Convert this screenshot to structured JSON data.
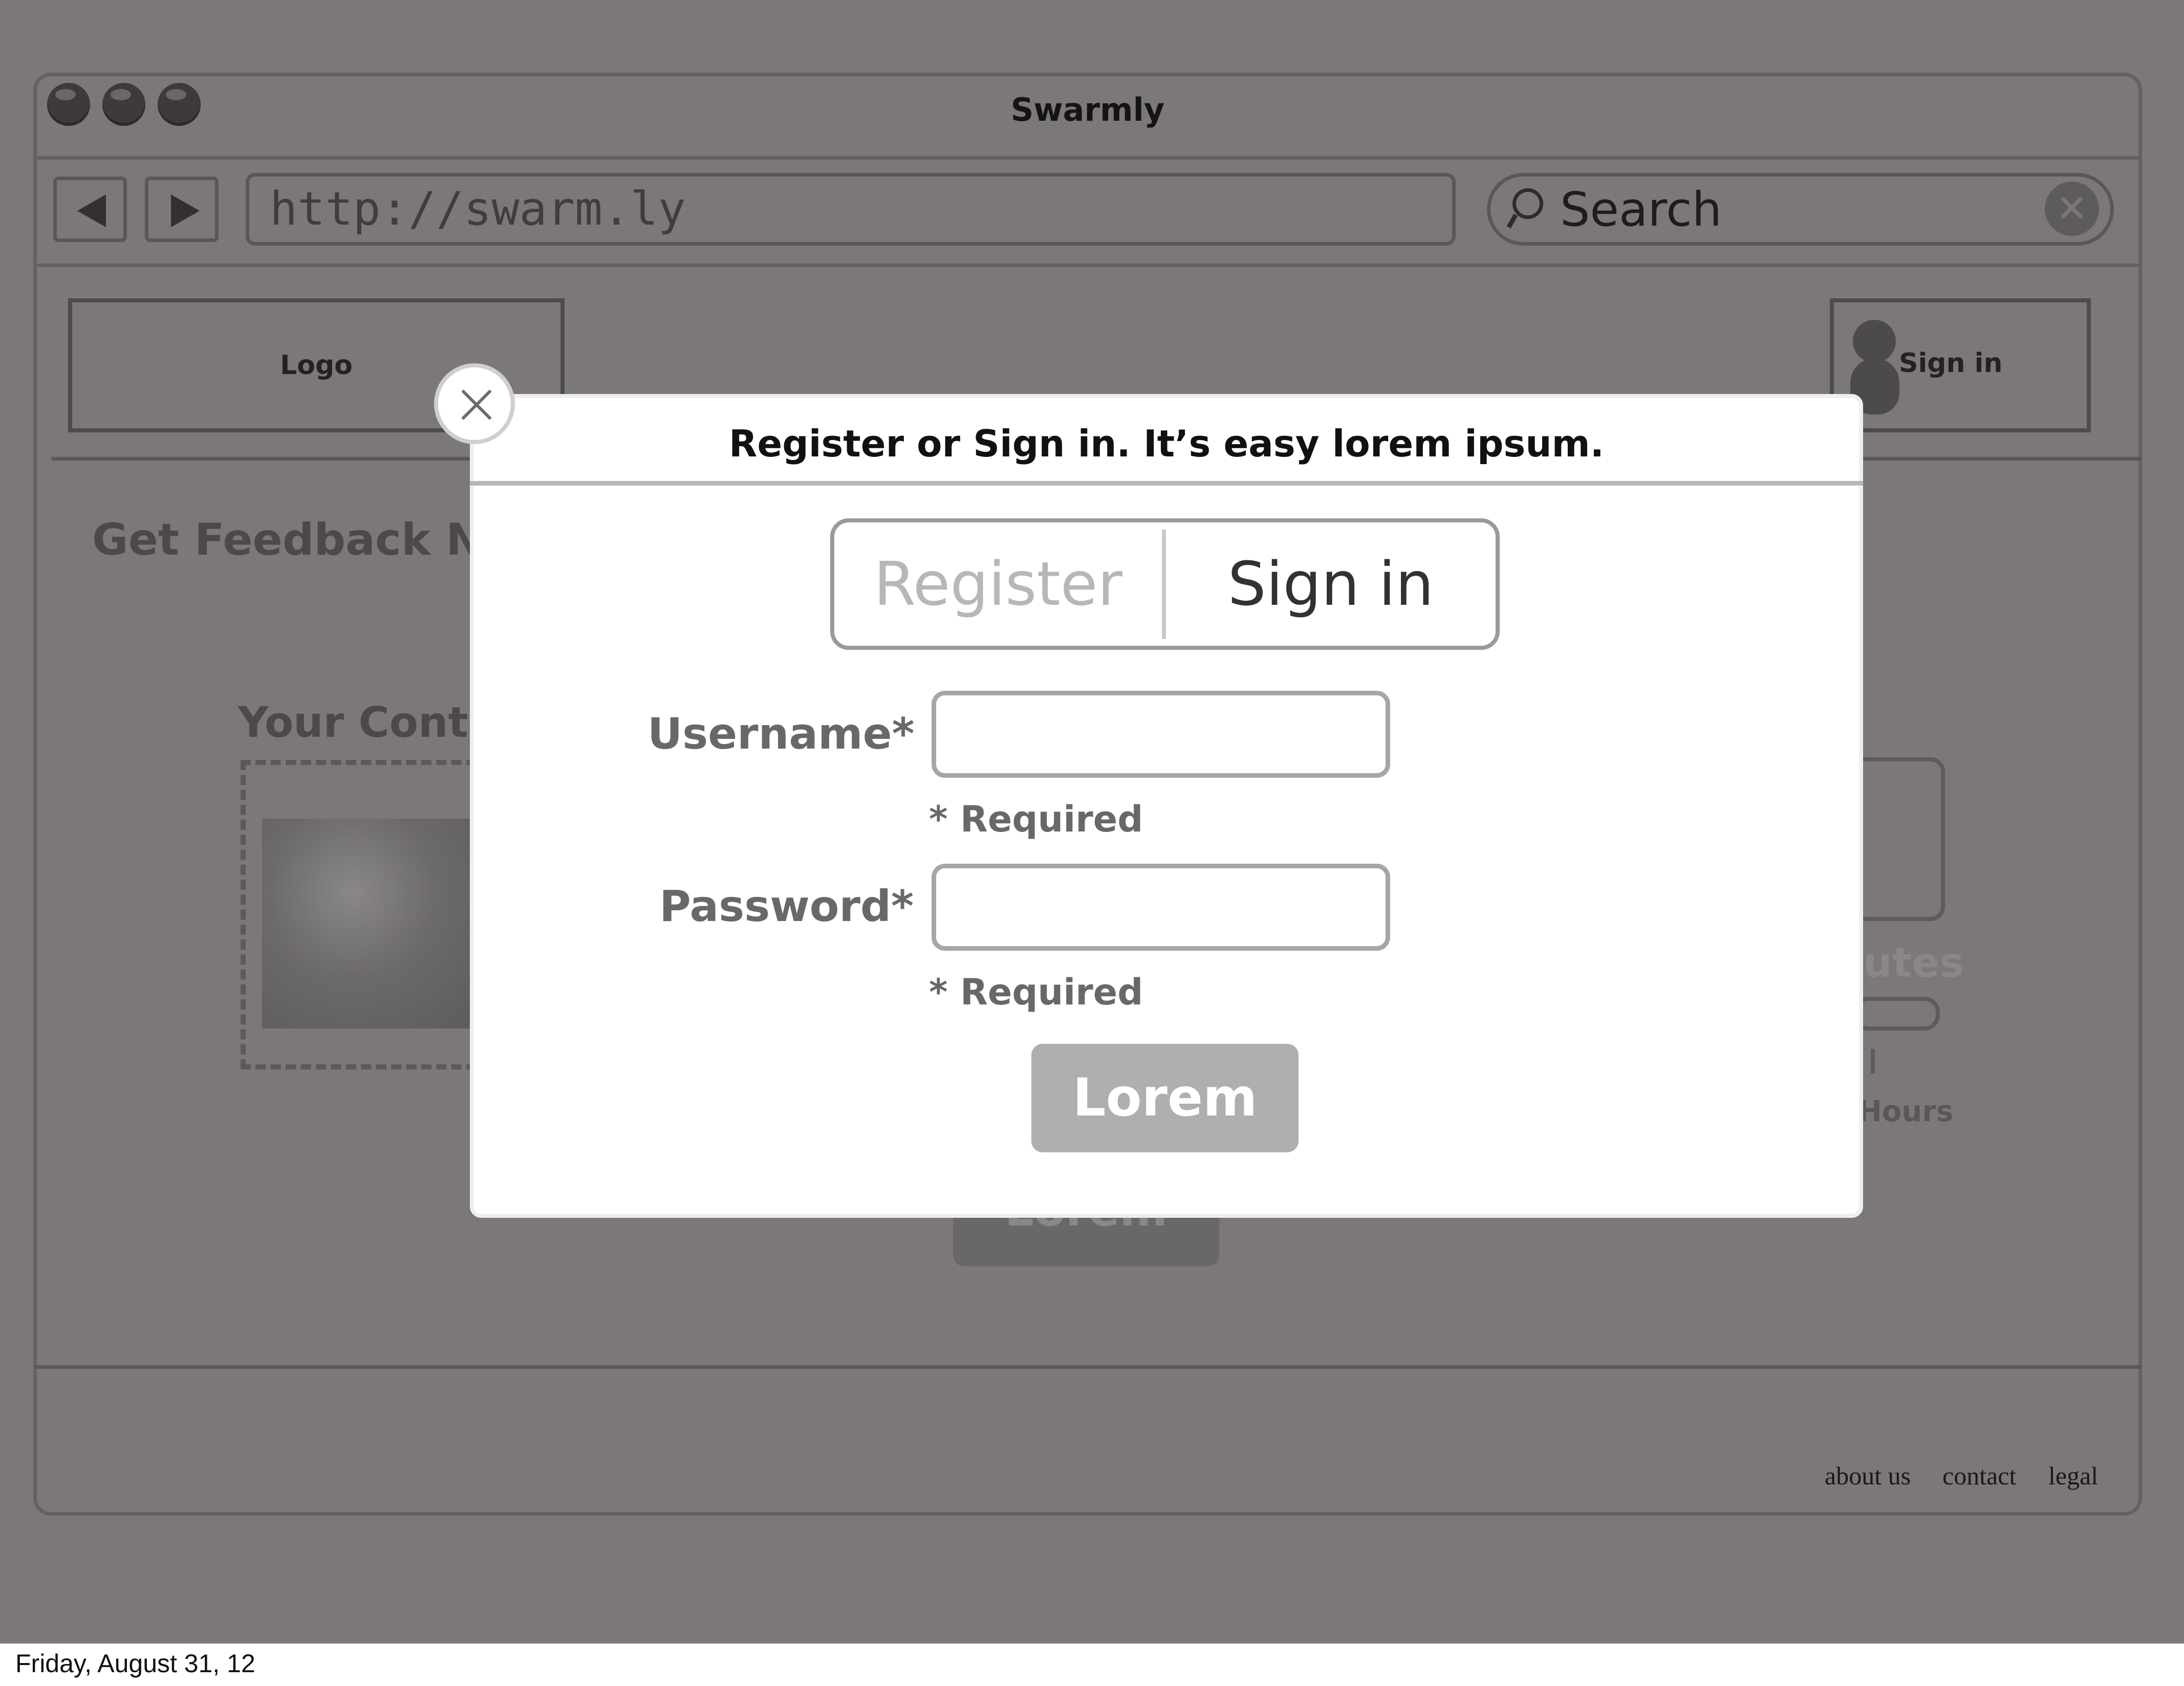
{
  "window": {
    "title": "Swarmly"
  },
  "nav": {
    "url": "http://swarm.ly",
    "search_placeholder": "Search"
  },
  "header": {
    "logo": "Logo",
    "sign_in": "Sign in"
  },
  "background": {
    "feedback_heading": "Get Feedback Now",
    "content_heading": "Your Content",
    "right_card_text": "utes",
    "right_hours": "Hours",
    "button_label": "Lorem"
  },
  "footer": {
    "links": [
      "about us",
      "contact",
      "legal"
    ]
  },
  "modal": {
    "title": "Register or Sign in.  It’s easy lorem ipsum.",
    "tabs": {
      "register": "Register",
      "sign_in": "Sign in",
      "active": "Sign in"
    },
    "username_label": "Username*",
    "username_value": "",
    "password_label": "Password*",
    "password_value": "",
    "required_note": "* Required",
    "submit_label": "Lorem"
  },
  "status": {
    "date": "Friday, August 31, 12"
  }
}
